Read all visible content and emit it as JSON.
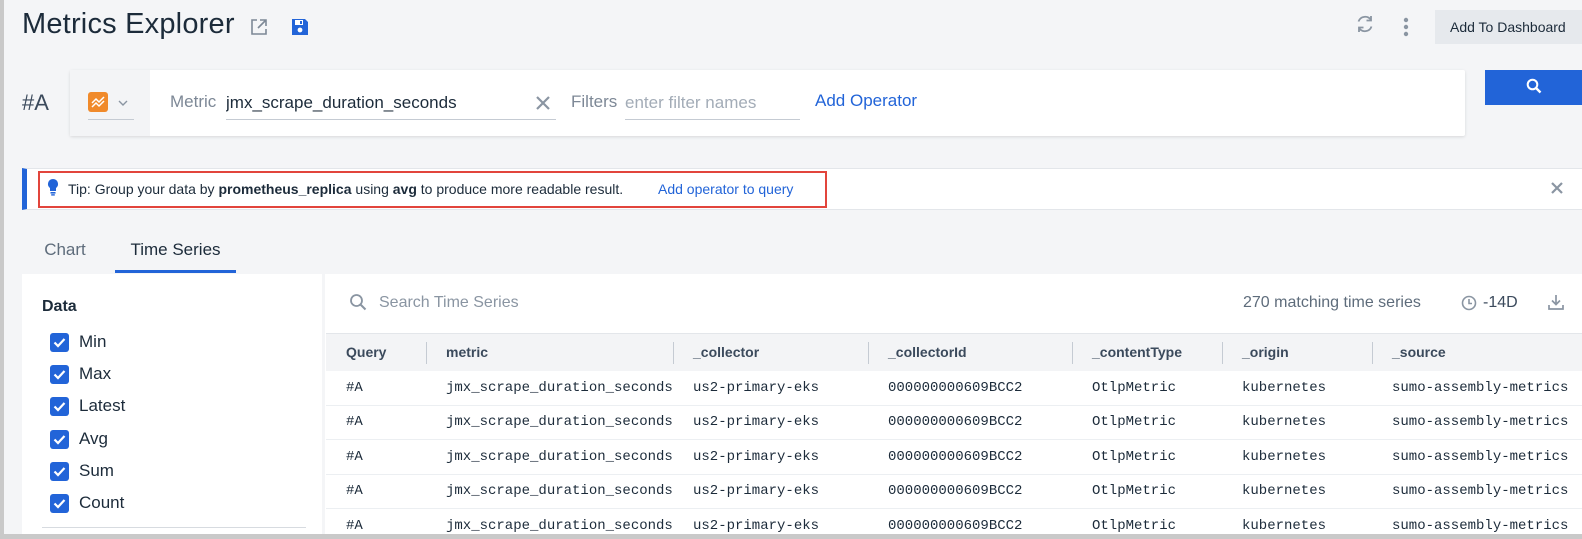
{
  "header": {
    "title": "Metrics Explorer",
    "add_to_dashboard_label": "Add To Dashboard"
  },
  "query": {
    "label": "#A",
    "metric_label": "Metric",
    "metric_value": "jmx_scrape_duration_seconds",
    "filters_label": "Filters",
    "filters_placeholder": "enter filter names",
    "add_operator_label": "Add Operator"
  },
  "tip": {
    "prefix": "Tip: Group your data by ",
    "group_key": "prometheus_replica",
    "middle": " using ",
    "function": "avg",
    "suffix": " to produce more readable result.",
    "action_label": "Add operator to query"
  },
  "tabs": [
    {
      "label": "Chart",
      "active": false
    },
    {
      "label": "Time Series",
      "active": true
    }
  ],
  "data_panel": {
    "heading": "Data",
    "options": [
      {
        "label": "Min",
        "checked": true
      },
      {
        "label": "Max",
        "checked": true
      },
      {
        "label": "Latest",
        "checked": true
      },
      {
        "label": "Avg",
        "checked": true
      },
      {
        "label": "Sum",
        "checked": true
      },
      {
        "label": "Count",
        "checked": true
      }
    ]
  },
  "series": {
    "search_placeholder": "Search Time Series",
    "match_count": "270 matching time series",
    "time_range": "-14D",
    "columns": [
      "Query",
      "metric",
      "_collector",
      "_collectorId",
      "_contentType",
      "_origin",
      "_source"
    ],
    "rows": [
      [
        "#A",
        "jmx_scrape_duration_seconds",
        "us2-primary-eks",
        "000000000609BCC2",
        "OtlpMetric",
        "kubernetes",
        "sumo-assembly-metrics"
      ],
      [
        "#A",
        "jmx_scrape_duration_seconds",
        "us2-primary-eks",
        "000000000609BCC2",
        "OtlpMetric",
        "kubernetes",
        "sumo-assembly-metrics"
      ],
      [
        "#A",
        "jmx_scrape_duration_seconds",
        "us2-primary-eks",
        "000000000609BCC2",
        "OtlpMetric",
        "kubernetes",
        "sumo-assembly-metrics"
      ],
      [
        "#A",
        "jmx_scrape_duration_seconds",
        "us2-primary-eks",
        "000000000609BCC2",
        "OtlpMetric",
        "kubernetes",
        "sumo-assembly-metrics"
      ],
      [
        "#A",
        "jmx_scrape_duration_seconds",
        "us2-primary-eks",
        "000000000609BCC2",
        "OtlpMetric",
        "kubernetes",
        "sumo-assembly-metrics"
      ]
    ]
  },
  "colors": {
    "accent": "#2264d8",
    "metric_type_badge": "#f08a2b",
    "tip_highlight": "#e2453c"
  },
  "icons": {
    "share": "share-icon",
    "save": "save-icon",
    "refresh": "refresh-icon",
    "more": "kebab-menu-icon",
    "metric_type": "chart-line-icon",
    "clear": "close-icon",
    "run": "search-icon",
    "tip": "lightbulb-icon",
    "dismiss": "close-icon",
    "series_search": "search-icon",
    "time_range": "clock-icon",
    "export": "download-icon"
  }
}
